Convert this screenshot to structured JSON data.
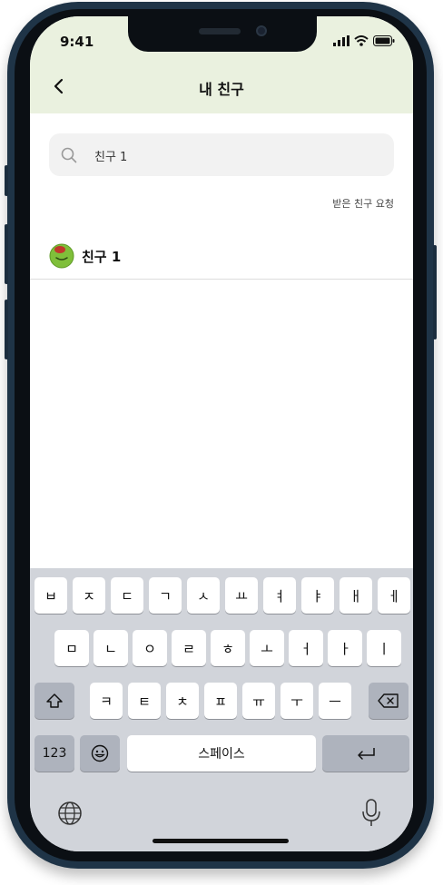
{
  "status_bar": {
    "time": "9:41"
  },
  "header": {
    "title": "내 친구"
  },
  "search": {
    "value": "친구 1"
  },
  "requests_link": "받은 친구 요청",
  "friends": [
    {
      "name": "친구 1"
    }
  ],
  "keyboard": {
    "row1": [
      "ㅂ",
      "ㅈ",
      "ㄷ",
      "ㄱ",
      "ㅅ",
      "ㅛ",
      "ㅕ",
      "ㅑ",
      "ㅐ",
      "ㅔ"
    ],
    "row2": [
      "ㅁ",
      "ㄴ",
      "ㅇ",
      "ㄹ",
      "ㅎ",
      "ㅗ",
      "ㅓ",
      "ㅏ",
      "ㅣ"
    ],
    "row3": [
      "ㅋ",
      "ㅌ",
      "ㅊ",
      "ㅍ",
      "ㅠ",
      "ㅜ",
      "ㅡ"
    ],
    "numbers_label": "123",
    "space_label": "스페이스"
  },
  "colors": {
    "header_bg": "#eaf1df",
    "frame": "#1f3447",
    "keyboard_bg": "#d1d4da"
  }
}
